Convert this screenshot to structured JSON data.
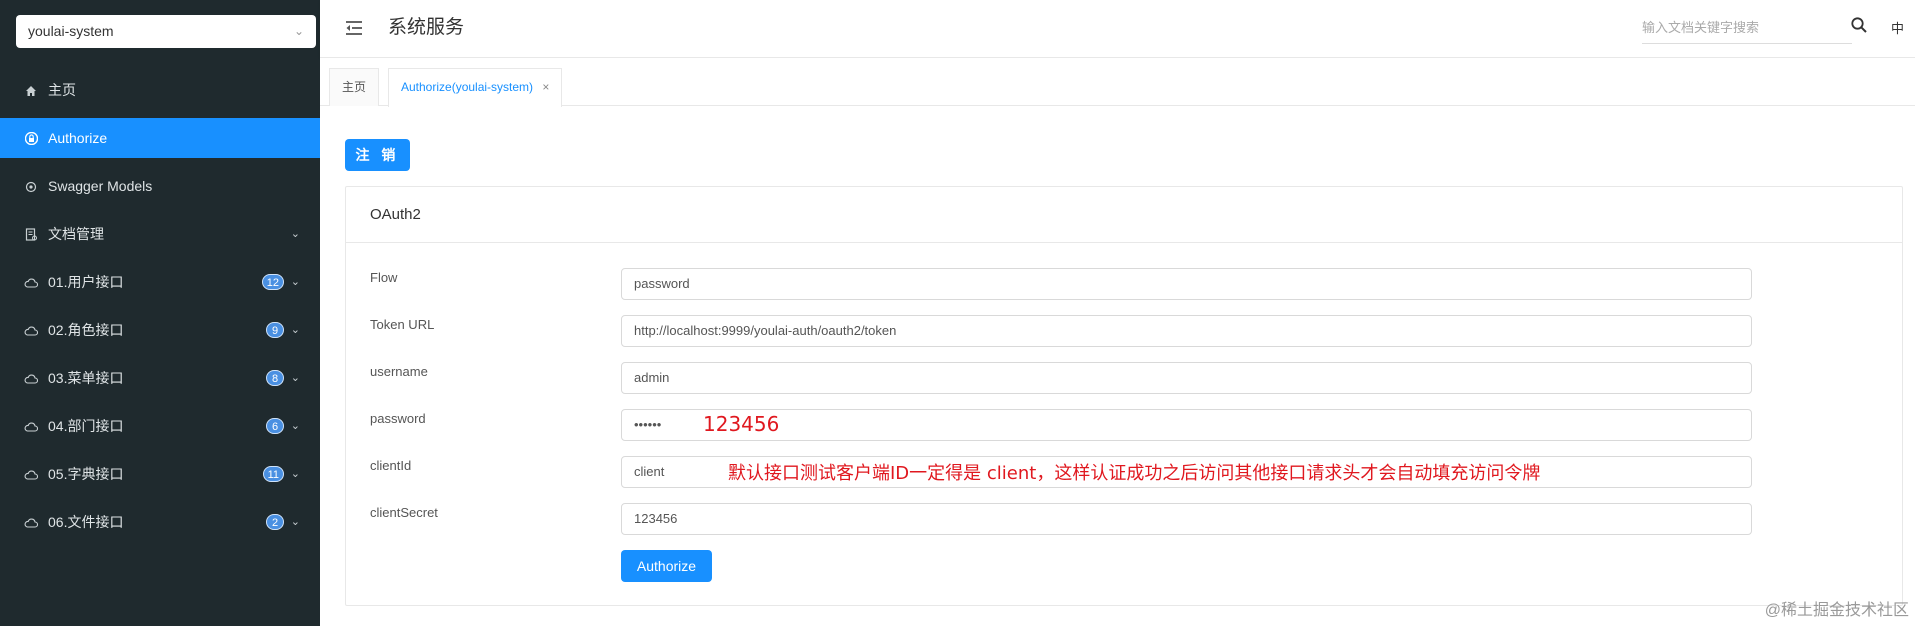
{
  "sidebar": {
    "group_select": {
      "value": "youlai-system"
    },
    "items": [
      {
        "label": "主页",
        "icon": "home-icon",
        "active": false
      },
      {
        "label": "Authorize",
        "icon": "lock-icon",
        "active": true
      },
      {
        "label": "Swagger Models",
        "icon": "model-icon",
        "active": false
      },
      {
        "label": "文档管理",
        "icon": "doc-icon",
        "active": false
      },
      {
        "label": "01.用户接口",
        "icon": "cloud-icon",
        "badge": "12"
      },
      {
        "label": "02.角色接口",
        "icon": "cloud-icon",
        "badge": "9"
      },
      {
        "label": "03.菜单接口",
        "icon": "cloud-icon",
        "badge": "8"
      },
      {
        "label": "04.部门接口",
        "icon": "cloud-icon",
        "badge": "6"
      },
      {
        "label": "05.字典接口",
        "icon": "cloud-icon",
        "badge": "11"
      },
      {
        "label": "06.文件接口",
        "icon": "cloud-icon",
        "badge": "2"
      }
    ]
  },
  "header": {
    "title": "系统服务",
    "search_placeholder": "输入文档关键字搜索",
    "lang": "中"
  },
  "tabs": [
    {
      "label": "主页",
      "active": false
    },
    {
      "label": "Authorize(youlai-system)",
      "active": true,
      "close": "×"
    }
  ],
  "main": {
    "logout_label": "注 销",
    "card_title": "OAuth2",
    "fields": [
      {
        "label": "Flow",
        "value": "password"
      },
      {
        "label": "Token URL",
        "value": "http://localhost:9999/youlai-auth/oauth2/token"
      },
      {
        "label": "username",
        "value": "admin"
      },
      {
        "label": "password",
        "value": "••••••"
      },
      {
        "label": "clientId",
        "value": "client"
      },
      {
        "label": "clientSecret",
        "value": "123456"
      }
    ],
    "authorize_label": "Authorize",
    "annotations": {
      "password_note": "123456",
      "client_note": "默认接口测试客户端ID一定得是 client，这样认证成功之后访问其他接口请求头才会自动填充访问令牌"
    }
  },
  "watermark": "@稀土掘金技术社区",
  "colors": {
    "accent": "#1890ff",
    "sidebar_bg": "#1f2a2e",
    "annotation": "#e0181f"
  }
}
